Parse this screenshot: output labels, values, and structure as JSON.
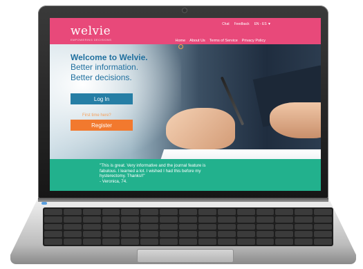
{
  "header": {
    "logo": "welvie",
    "tagline": "EMPOWERING DECISIONS",
    "utility_nav": [
      "Chat",
      "Feedback",
      "EN - ES ▼"
    ],
    "main_nav": [
      "Home",
      "About Us",
      "Terms of Service",
      "Privacy Policy"
    ]
  },
  "hero": {
    "title": "Welcome to Welvie.",
    "line1": "Better information.",
    "line2": "Better decisions.",
    "login_label": "Log In",
    "first_time_text": "First time here?",
    "register_label": "Register"
  },
  "testimonial": {
    "lines": [
      "\"This is great. Very informative and the journal feature is",
      "fabulous. I learned a lot. I wished I had this before my",
      "hysterectomy. Thanks!!\"",
      "- Veronica, 74."
    ]
  },
  "colors": {
    "header_bg": "#e8497a",
    "brand_blue": "#1f6f9e",
    "login_bg": "#267ea5",
    "register_bg": "#f2792e",
    "testimonial_bg": "#22b18d"
  }
}
